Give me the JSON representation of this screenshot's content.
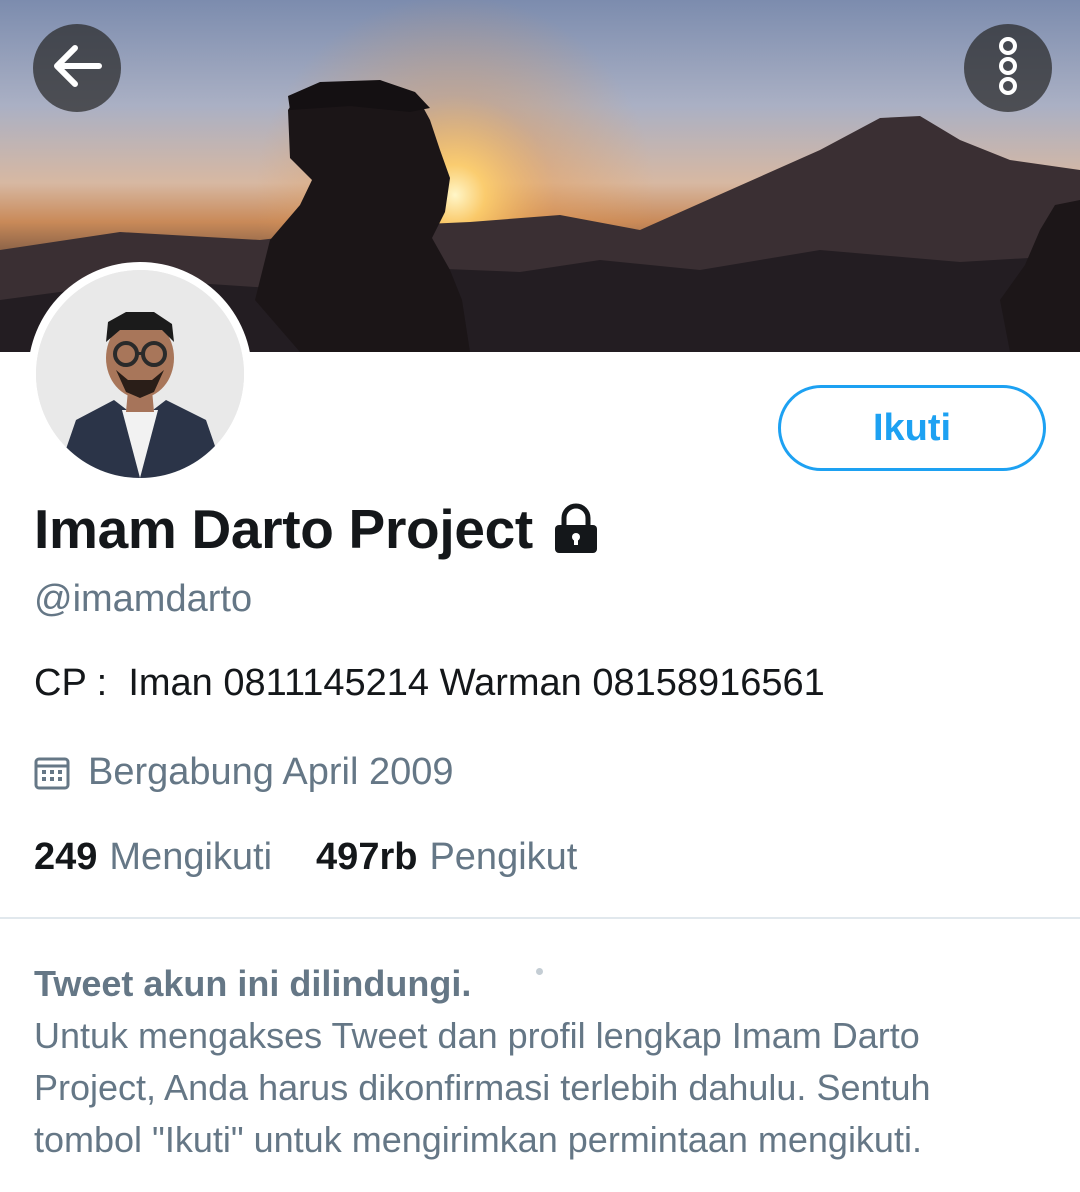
{
  "header": {
    "back_icon": "arrow-left-icon",
    "more_icon": "vertical-dots-icon",
    "banner": "sunrise-mountain-photo"
  },
  "profile": {
    "display_name": "Imam Darto Project",
    "protected_icon": "lock-icon",
    "handle": "@imamdarto",
    "bio": "CP :  Iman 0811145214 Warman 08158916561",
    "joined_icon": "calendar-icon",
    "joined": "Bergabung April 2009",
    "follow_button": "Ikuti",
    "following_count": "249",
    "following_label": "Mengikuti",
    "followers_count": "497rb",
    "followers_label": "Pengikut"
  },
  "protected_notice": {
    "title": "Tweet akun ini dilindungi.",
    "description": "Untuk mengakses Tweet dan profil lengkap Imam Darto Project, Anda harus dikonfirmasi terlebih dahulu. Sentuh tombol \"Ikuti\" untuk mengirimkan permintaan mengikuti."
  },
  "colors": {
    "accent": "#1da1f2",
    "secondary_text": "#657786",
    "primary_text": "#14171a"
  }
}
